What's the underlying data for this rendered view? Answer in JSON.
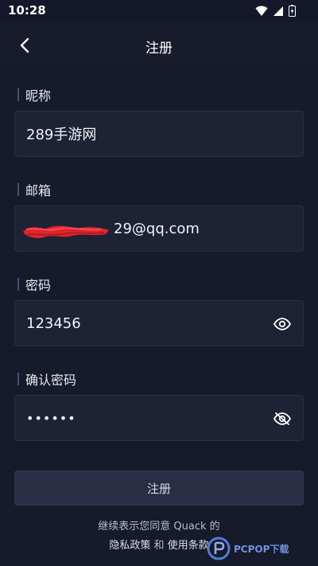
{
  "status_bar": {
    "time": "10:28"
  },
  "app_bar": {
    "title": "注册",
    "back_icon": "chevron-left-icon"
  },
  "form": {
    "nickname": {
      "label": "昵称",
      "value": "289手游网"
    },
    "email": {
      "label": "邮箱",
      "visible_value": "29@qq.com"
    },
    "password": {
      "label": "密码",
      "value": "123456",
      "icon": "eye-open-icon"
    },
    "confirm_password": {
      "label": "确认密码",
      "value": "••••••",
      "icon": "eye-closed-icon"
    }
  },
  "submit_label": "注册",
  "terms": {
    "line1": "继续表示您同意 Quack 的",
    "privacy_link": "隐私政策",
    "conjunction": " 和 ",
    "terms_link": "使用条款"
  },
  "watermark_text": "PCPOP下载",
  "colors": {
    "background": "#161a2b",
    "field_bg": "#1e2235",
    "button_bg": "#2a2e44",
    "redaction": "#e0242e"
  }
}
